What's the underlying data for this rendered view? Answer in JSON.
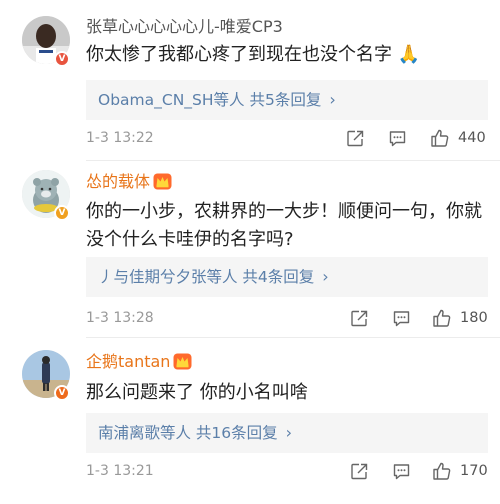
{
  "comments": [
    {
      "username": "张草心心心心心儿-唯爱CP3",
      "text": "你太惨了我都心疼了到现在也没个名字 🙏",
      "replies": "Obama_CN_SH等人 共5条回复",
      "time": "1-3 13:22",
      "likes": "440",
      "badge": "V",
      "name_color": "#555555",
      "verified": "red"
    },
    {
      "username": "怂的载体",
      "text": "你的一小步，农耕界的一大步！顺便问一句，你就没个什么卡哇伊的名字吗?",
      "replies": "丿与佳期兮夕张等人 共4条回复",
      "time": "1-3 13:28",
      "likes": "180",
      "badge": "V",
      "name_color": "#e8751a",
      "verified": "gold"
    },
    {
      "username": "企鹅tantan",
      "text": "那么问题来了 你的小名叫啥",
      "replies": "南浦离歌等人 共16条回复",
      "time": "1-3 13:21",
      "likes": "170",
      "badge": "V",
      "name_color": "#e8751a",
      "verified": "orange"
    }
  ],
  "icons": {
    "share": "share-icon",
    "comment": "comment-icon",
    "like": "thumbs-up-icon",
    "crown": "vip-crown-icon",
    "chevron": "chevron-right-icon"
  },
  "reply_chevron": "›",
  "colors": {
    "link_blue": "#5b7fa9",
    "orange_name": "#e8751a",
    "reply_bg": "#f5f5f5"
  }
}
